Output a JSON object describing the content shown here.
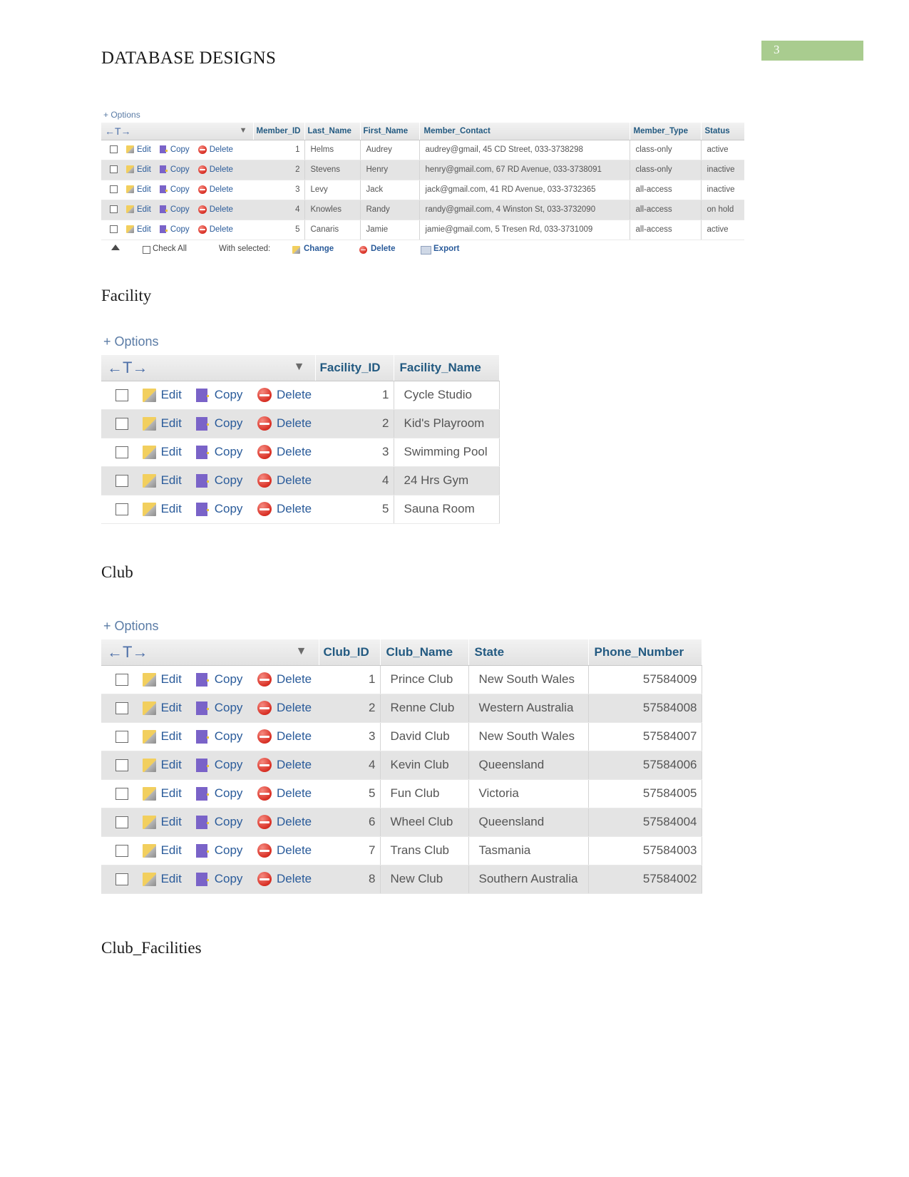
{
  "document": {
    "header_title": "DATABASE DESIGNS",
    "page_number": "3"
  },
  "headings": {
    "facility": "Facility",
    "club": "Club",
    "club_facilities": "Club_Facilities"
  },
  "common": {
    "options_label": "+ Options",
    "nav_arrows": "←T→",
    "sort_caret": "▼",
    "edit_label": "Edit",
    "copy_label": "Copy",
    "delete_label": "Delete",
    "check_all_label": "Check All",
    "with_selected_label": "With selected:",
    "change_label": "Change",
    "footer_delete_label": "Delete",
    "export_label": "Export"
  },
  "colors": {
    "header_text": "#235a81",
    "link": "#2a5b9a",
    "options_link": "#5b7ca6",
    "row_alt": "#e4e4e4",
    "badge_green": "#a9cc8f",
    "delete_red": "#d93025",
    "pencil_yellow": "#f2cf5e",
    "copy_purple": "#7a63c8"
  },
  "member_table": {
    "name": "Member",
    "columns": [
      "Member_ID",
      "Last_Name",
      "First_Name",
      "Member_Contact",
      "Member_Type",
      "Status"
    ],
    "rows": [
      {
        "id": "1",
        "last_name": "Helms",
        "first_name": "Audrey",
        "contact": "audrey@gmail, 45 CD Street, 033-3738298",
        "type": "class-only",
        "status": "active"
      },
      {
        "id": "2",
        "last_name": "Stevens",
        "first_name": "Henry",
        "contact": "henry@gmail.com, 67 RD Avenue, 033-3738091",
        "type": "class-only",
        "status": "inactive"
      },
      {
        "id": "3",
        "last_name": "Levy",
        "first_name": "Jack",
        "contact": "jack@gmail.com, 41 RD Avenue, 033-3732365",
        "type": "all-access",
        "status": "inactive"
      },
      {
        "id": "4",
        "last_name": "Knowles",
        "first_name": "Randy",
        "contact": "randy@gmail.com, 4 Winston St, 033-3732090",
        "type": "all-access",
        "status": "on hold"
      },
      {
        "id": "5",
        "last_name": "Canaris",
        "first_name": "Jamie",
        "contact": "jamie@gmail.com, 5 Tresen Rd, 033-3731009",
        "type": "all-access",
        "status": "active"
      }
    ]
  },
  "facility_table": {
    "name": "Facility",
    "columns": [
      "Facility_ID",
      "Facility_Name"
    ],
    "rows": [
      {
        "id": "1",
        "facility_name": "Cycle Studio"
      },
      {
        "id": "2",
        "facility_name": "Kid's Playroom"
      },
      {
        "id": "3",
        "facility_name": "Swimming Pool"
      },
      {
        "id": "4",
        "facility_name": "24 Hrs Gym"
      },
      {
        "id": "5",
        "facility_name": "Sauna Room"
      }
    ]
  },
  "club_table": {
    "name": "Club",
    "columns": [
      "Club_ID",
      "Club_Name",
      "State",
      "Phone_Number"
    ],
    "rows": [
      {
        "id": "1",
        "club_name": "Prince Club",
        "state": "New South Wales",
        "phone": "57584009"
      },
      {
        "id": "2",
        "club_name": "Renne Club",
        "state": "Western Australia",
        "phone": "57584008"
      },
      {
        "id": "3",
        "club_name": "David Club",
        "state": "New South Wales",
        "phone": "57584007"
      },
      {
        "id": "4",
        "club_name": "Kevin Club",
        "state": "Queensland",
        "phone": "57584006"
      },
      {
        "id": "5",
        "club_name": "Fun Club",
        "state": "Victoria",
        "phone": "57584005"
      },
      {
        "id": "6",
        "club_name": "Wheel Club",
        "state": "Queensland",
        "phone": "57584004"
      },
      {
        "id": "7",
        "club_name": "Trans Club",
        "state": "Tasmania",
        "phone": "57584003"
      },
      {
        "id": "8",
        "club_name": "New Club",
        "state": "Southern Australia",
        "phone": "57584002"
      }
    ]
  }
}
